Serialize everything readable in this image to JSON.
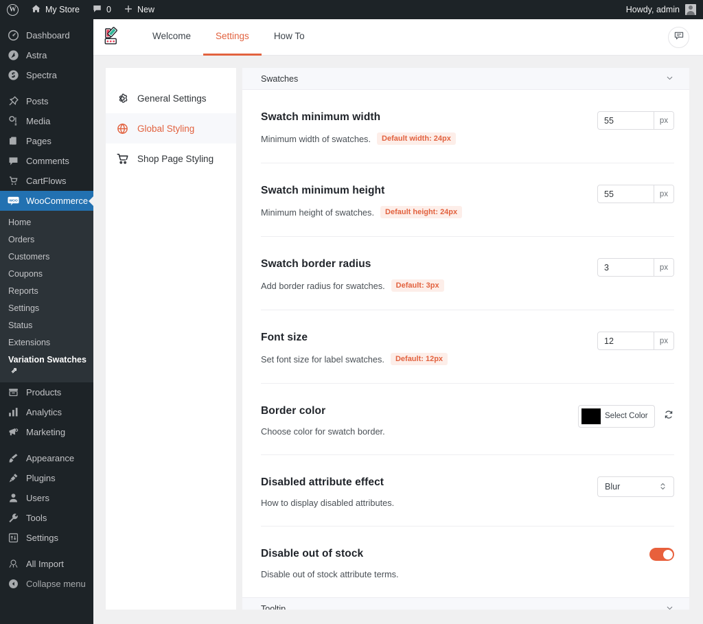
{
  "adminbar": {
    "wp_logo": "wordpress-logo",
    "site_name": "My Store",
    "comments_count": "0",
    "new_label": "New",
    "howdy": "Howdy, admin"
  },
  "adminmenu": {
    "items": [
      {
        "label": "Dashboard",
        "icon": "dashboard-icon",
        "current": false
      },
      {
        "label": "Astra",
        "icon": "astra-icon",
        "current": false
      },
      {
        "label": "Spectra",
        "icon": "spectra-icon",
        "current": false
      },
      {
        "label": "Posts",
        "icon": "pin-icon",
        "current": false
      },
      {
        "label": "Media",
        "icon": "media-icon",
        "current": false
      },
      {
        "label": "Pages",
        "icon": "pages-icon",
        "current": false
      },
      {
        "label": "Comments",
        "icon": "comment-icon",
        "current": false
      },
      {
        "label": "CartFlows",
        "icon": "cartflows-icon",
        "current": false
      },
      {
        "label": "WooCommerce",
        "icon": "woocommerce-icon",
        "current": true
      },
      {
        "label": "Products",
        "icon": "products-icon",
        "current": false
      },
      {
        "label": "Analytics",
        "icon": "analytics-icon",
        "current": false
      },
      {
        "label": "Marketing",
        "icon": "megaphone-icon",
        "current": false
      },
      {
        "label": "Appearance",
        "icon": "brush-icon",
        "current": false
      },
      {
        "label": "Plugins",
        "icon": "plug-icon",
        "current": false
      },
      {
        "label": "Users",
        "icon": "user-icon",
        "current": false
      },
      {
        "label": "Tools",
        "icon": "wrench-icon",
        "current": false
      },
      {
        "label": "Settings",
        "icon": "settings-icon",
        "current": false
      },
      {
        "label": "All Import",
        "icon": "all-import-icon",
        "current": false
      },
      {
        "label": "Collapse menu",
        "icon": "collapse-icon",
        "current": false
      }
    ],
    "woocommerce_submenu": [
      {
        "label": "Home",
        "current": false
      },
      {
        "label": "Orders",
        "current": false
      },
      {
        "label": "Customers",
        "current": false
      },
      {
        "label": "Coupons",
        "current": false
      },
      {
        "label": "Reports",
        "current": false
      },
      {
        "label": "Settings",
        "current": false
      },
      {
        "label": "Status",
        "current": false
      },
      {
        "label": "Extensions",
        "current": false
      },
      {
        "label": "Variation Swatches",
        "current": true,
        "external": "⇗"
      }
    ]
  },
  "plugin_header": {
    "logo": "variation-swatches-logo",
    "tabs": [
      {
        "label": "Welcome",
        "active": false
      },
      {
        "label": "Settings",
        "active": true
      },
      {
        "label": "How To",
        "active": false
      }
    ],
    "feedback_icon": "speech-bubble-icon"
  },
  "settings_nav": {
    "items": [
      {
        "label": "General Settings",
        "icon": "gear-icon",
        "active": false
      },
      {
        "label": "Global Styling",
        "icon": "globe-icon",
        "active": true
      },
      {
        "label": "Shop Page Styling",
        "icon": "cart-icon",
        "active": false
      }
    ]
  },
  "panels": {
    "swatches": {
      "title": "Swatches",
      "chevron": "chevron-down-icon",
      "rows": [
        {
          "title": "Swatch minimum width",
          "desc": "Minimum width of swatches.",
          "badge": "Default width: 24px",
          "control": "number",
          "value": "55",
          "unit": "px"
        },
        {
          "title": "Swatch minimum height",
          "desc": "Minimum height of swatches.",
          "badge": "Default height: 24px",
          "control": "number",
          "value": "55",
          "unit": "px"
        },
        {
          "title": "Swatch border radius",
          "desc": "Add border radius for swatches.",
          "badge": "Default: 3px",
          "control": "number",
          "value": "3",
          "unit": "px"
        },
        {
          "title": "Font size",
          "desc": "Set font size for label swatches.",
          "badge": "Default: 12px",
          "control": "number",
          "value": "12",
          "unit": "px"
        },
        {
          "title": "Border color",
          "desc": "Choose color for swatch border.",
          "badge": "",
          "control": "color",
          "color_value": "#000000",
          "color_label": "Select Color",
          "reset_icon": "reset-icon"
        },
        {
          "title": "Disabled attribute effect",
          "desc": "How to display disabled attributes.",
          "badge": "",
          "control": "select",
          "value": "Blur"
        },
        {
          "title": "Disable out of stock",
          "desc": "Disable out of stock attribute terms.",
          "badge": "",
          "control": "toggle",
          "toggle_on": true,
          "toggle_color": "#e8603c"
        }
      ]
    },
    "tooltip": {
      "title": "Tooltip",
      "chevron": "chevron-down-icon"
    }
  },
  "colors": {
    "accent": "#e2623f",
    "admin_bg": "#1d2327",
    "submenu_bg": "#2c3338",
    "current_menu": "#2271b1",
    "page_bg": "#f0f0f1"
  }
}
